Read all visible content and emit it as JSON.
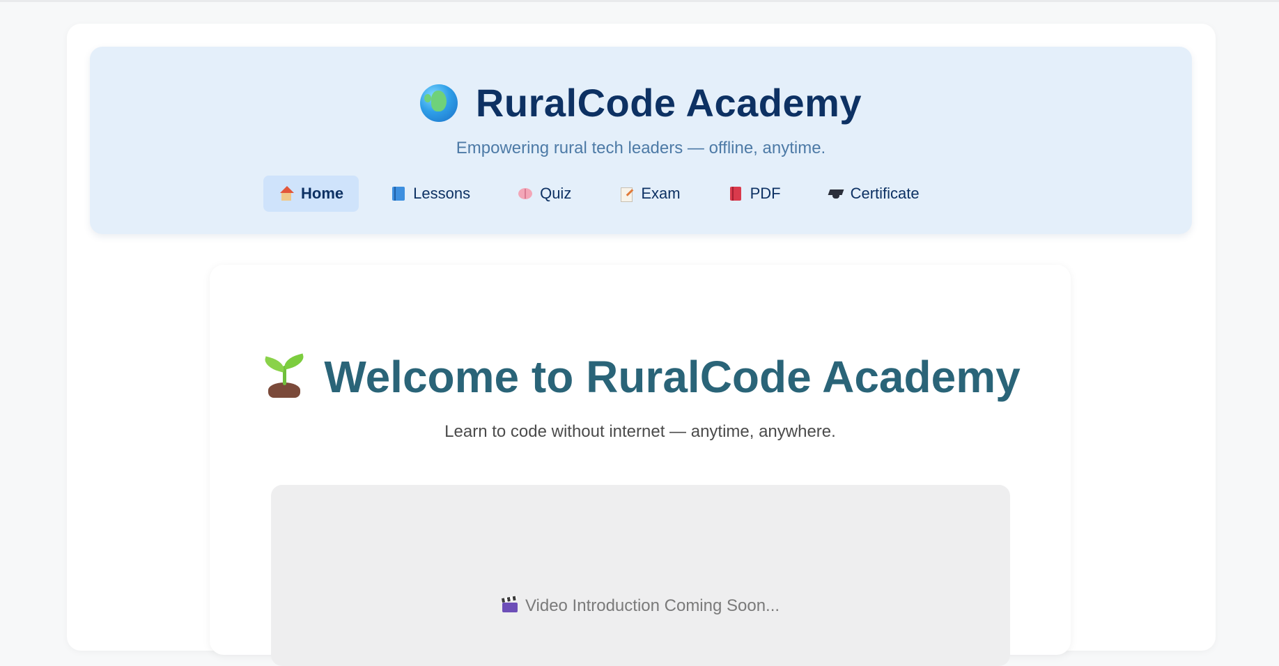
{
  "header": {
    "title": "RuralCode Academy",
    "tagline": "Empowering rural tech leaders — offline, anytime.",
    "logo_icon": "globe-icon"
  },
  "nav": {
    "items": [
      {
        "label": "Home",
        "icon": "house-icon",
        "active": true
      },
      {
        "label": "Lessons",
        "icon": "book-icon",
        "active": false
      },
      {
        "label": "Quiz",
        "icon": "brain-icon",
        "active": false
      },
      {
        "label": "Exam",
        "icon": "memo-icon",
        "active": false
      },
      {
        "label": "PDF",
        "icon": "red-book-icon",
        "active": false
      },
      {
        "label": "Certificate",
        "icon": "graduation-cap-icon",
        "active": false
      }
    ]
  },
  "main": {
    "welcome_title": "Welcome to RuralCode Academy",
    "welcome_icon": "seedling-icon",
    "subtitle": "Learn to code without internet — anytime, anywhere.",
    "video": {
      "label": "Video Introduction Coming Soon...",
      "icon": "clapper-icon"
    }
  },
  "colors": {
    "brand": "#0d3163",
    "accent_title": "#2a6478",
    "header_bg": "#e4effa",
    "active_nav_bg": "#cfe3fb"
  }
}
